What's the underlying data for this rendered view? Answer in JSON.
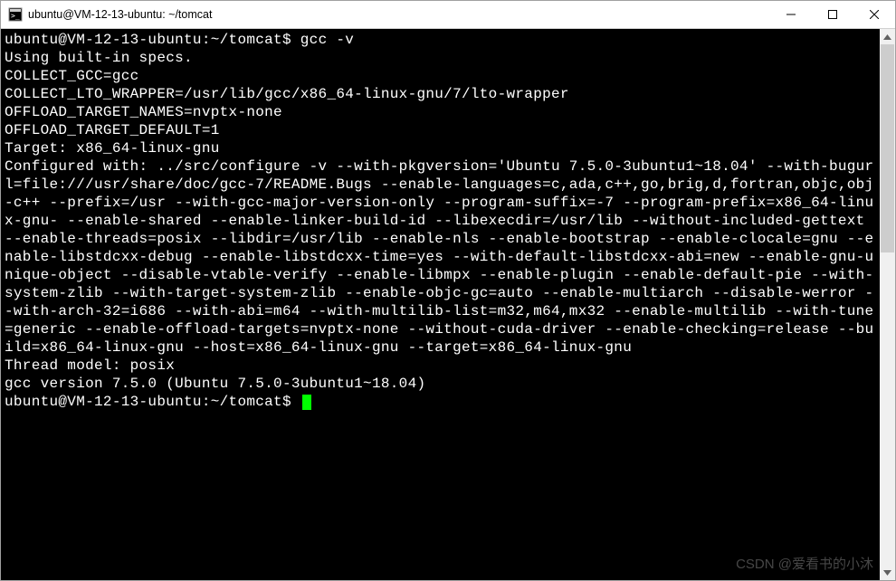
{
  "window": {
    "title": "ubuntu@VM-12-13-ubuntu: ~/tomcat",
    "icon_name": "terminal-icon"
  },
  "controls": {
    "minimize": "minimize-button",
    "maximize": "maximize-button",
    "close": "close-button"
  },
  "terminal": {
    "prompt1": "ubuntu@VM-12-13-ubuntu:~/tomcat$ ",
    "command1": "gcc -v",
    "lines": [
      "Using built-in specs.",
      "COLLECT_GCC=gcc",
      "COLLECT_LTO_WRAPPER=/usr/lib/gcc/x86_64-linux-gnu/7/lto-wrapper",
      "OFFLOAD_TARGET_NAMES=nvptx-none",
      "OFFLOAD_TARGET_DEFAULT=1",
      "Target: x86_64-linux-gnu",
      "Configured with: ../src/configure -v --with-pkgversion='Ubuntu 7.5.0-3ubuntu1~18.04' --with-bugurl=file:///usr/share/doc/gcc-7/README.Bugs --enable-languages=c,ada,c++,go,brig,d,fortran,objc,obj-c++ --prefix=/usr --with-gcc-major-version-only --program-suffix=-7 --program-prefix=x86_64-linux-gnu- --enable-shared --enable-linker-build-id --libexecdir=/usr/lib --without-included-gettext --enable-threads=posix --libdir=/usr/lib --enable-nls --enable-bootstrap --enable-clocale=gnu --enable-libstdcxx-debug --enable-libstdcxx-time=yes --with-default-libstdcxx-abi=new --enable-gnu-unique-object --disable-vtable-verify --enable-libmpx --enable-plugin --enable-default-pie --with-system-zlib --with-target-system-zlib --enable-objc-gc=auto --enable-multiarch --disable-werror --with-arch-32=i686 --with-abi=m64 --with-multilib-list=m32,m64,mx32 --enable-multilib --with-tune=generic --enable-offload-targets=nvptx-none --without-cuda-driver --enable-checking=release --build=x86_64-linux-gnu --host=x86_64-linux-gnu --target=x86_64-linux-gnu",
      "Thread model: posix",
      "gcc version 7.5.0 (Ubuntu 7.5.0-3ubuntu1~18.04)"
    ],
    "prompt2": "ubuntu@VM-12-13-ubuntu:~/tomcat$ "
  },
  "watermark": "CSDN @爱看书的小沐"
}
